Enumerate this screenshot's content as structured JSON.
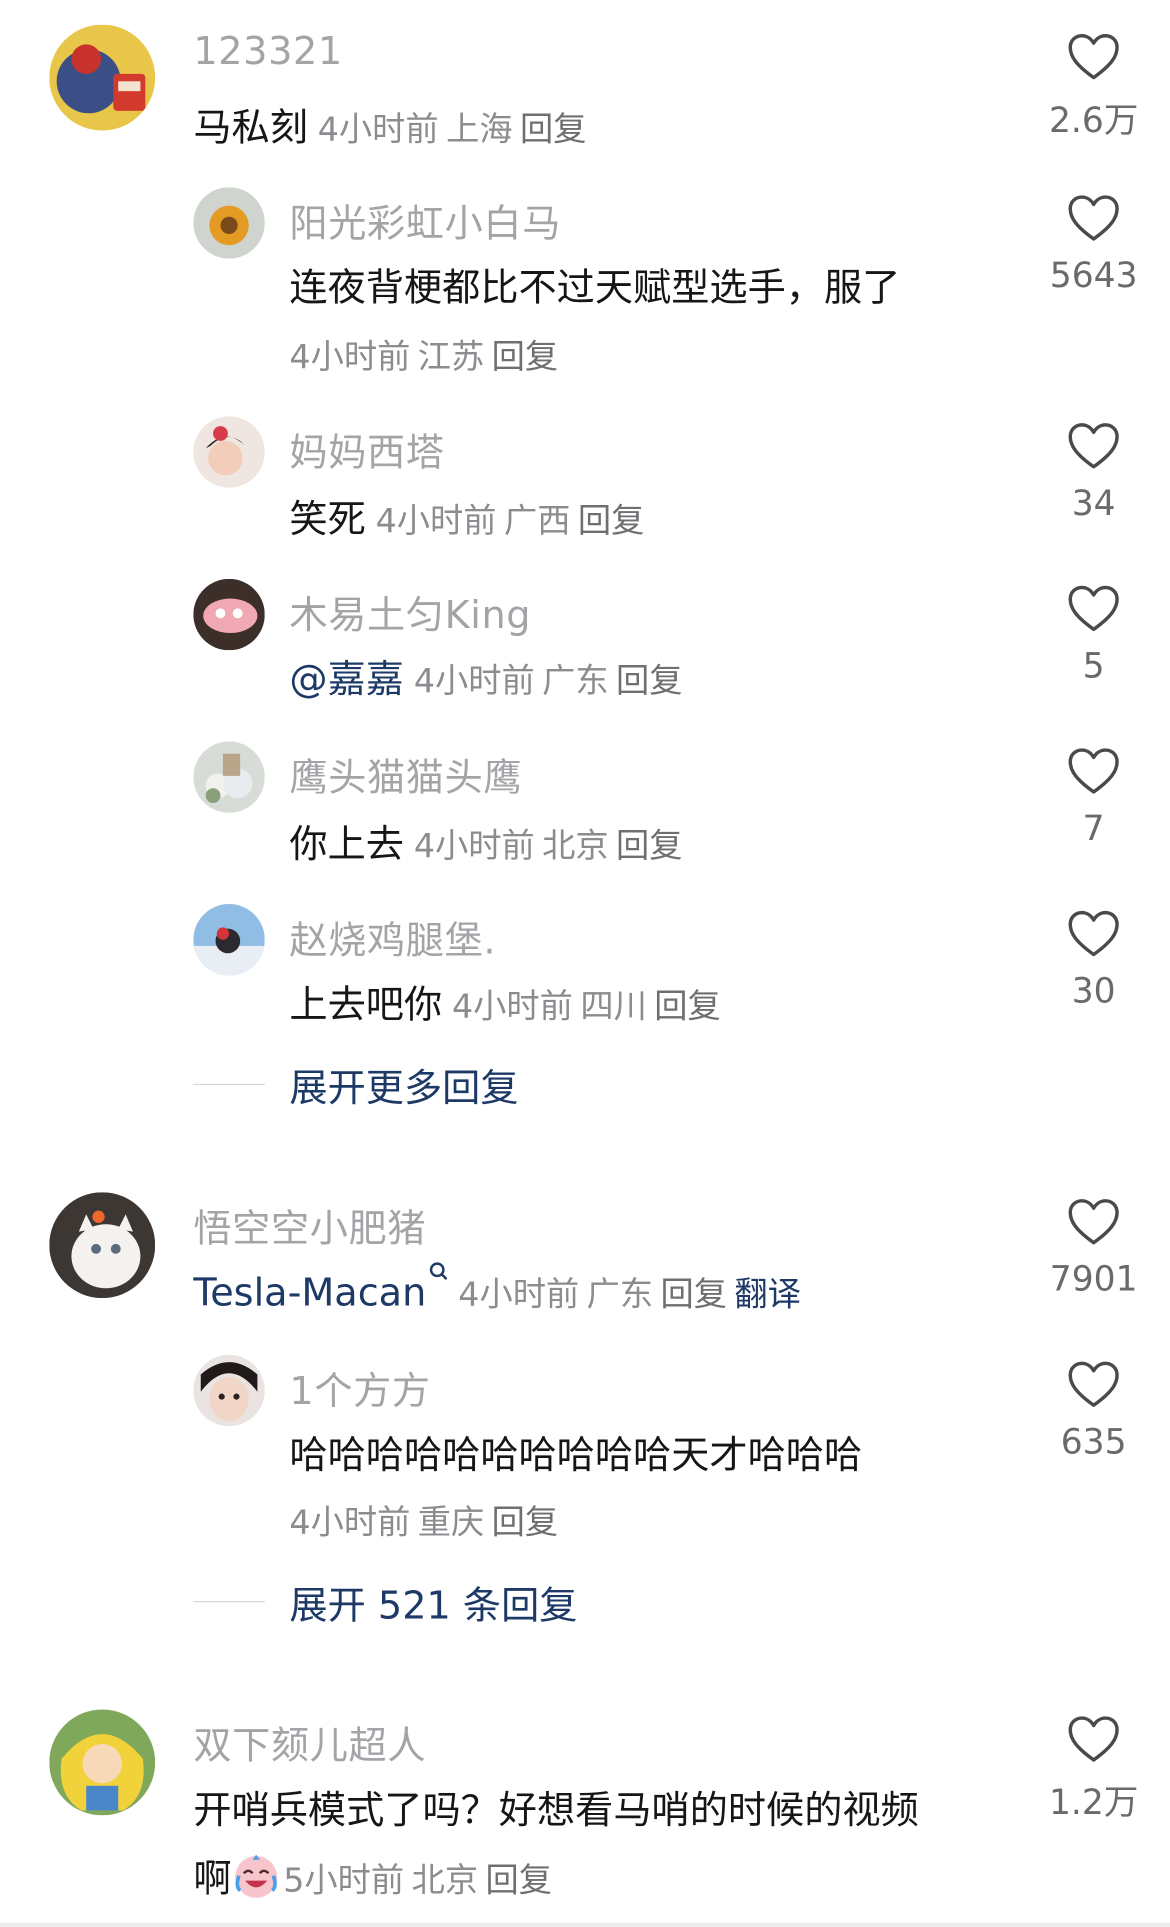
{
  "comments": [
    {
      "username": "123321",
      "text": "马私刻",
      "time": "4小时前",
      "location": "上海",
      "reply_label": "回复",
      "likes": "2.6万",
      "replies": [
        {
          "username": "阳光彩虹小白马",
          "text": "连夜背梗都比不过天赋型选手，服了",
          "time": "4小时前",
          "location": "江苏",
          "reply_label": "回复",
          "likes": "5643"
        },
        {
          "username": "妈妈西塔",
          "text": "笑死",
          "time": "4小时前",
          "location": "广西",
          "reply_label": "回复",
          "likes": "34"
        },
        {
          "username": "木易土匀King",
          "mention": "@嘉嘉",
          "time": "4小时前",
          "location": "广东",
          "reply_label": "回复",
          "likes": "5"
        },
        {
          "username": "鹰头猫猫头鹰",
          "text": "你上去",
          "time": "4小时前",
          "location": "北京",
          "reply_label": "回复",
          "likes": "7"
        },
        {
          "username": "赵烧鸡腿堡.",
          "text": "上去吧你",
          "time": "4小时前",
          "location": "四川",
          "reply_label": "回复",
          "likes": "30"
        }
      ],
      "expand_label": "展开更多回复"
    },
    {
      "username": "悟空空小肥猪",
      "mention": "Tesla-Macan",
      "time": "4小时前",
      "location": "广东",
      "reply_label": "回复",
      "translate_label": "翻译",
      "likes": "7901",
      "replies": [
        {
          "username": "1个方方",
          "text": "哈哈哈哈哈哈哈哈哈哈天才哈哈哈",
          "time": "4小时前",
          "location": "重庆",
          "reply_label": "回复",
          "likes": "635"
        }
      ],
      "expand_label": "展开 521 条回复"
    },
    {
      "username": "双下颏儿超人",
      "text_line1": "开哨兵模式了吗？好想看马哨的时候的视频",
      "text_line2": "啊",
      "time": "5小时前",
      "location": "北京",
      "reply_label": "回复",
      "likes": "1.2万"
    }
  ],
  "icons": {
    "like": "heart-outline-icon",
    "search_hint": "search-icon",
    "emoji": "crying-laugh-emoji"
  },
  "colors": {
    "username": "#a4a4a8",
    "text": "#161616",
    "meta": "#8c8c90",
    "link": "#1d3966"
  }
}
